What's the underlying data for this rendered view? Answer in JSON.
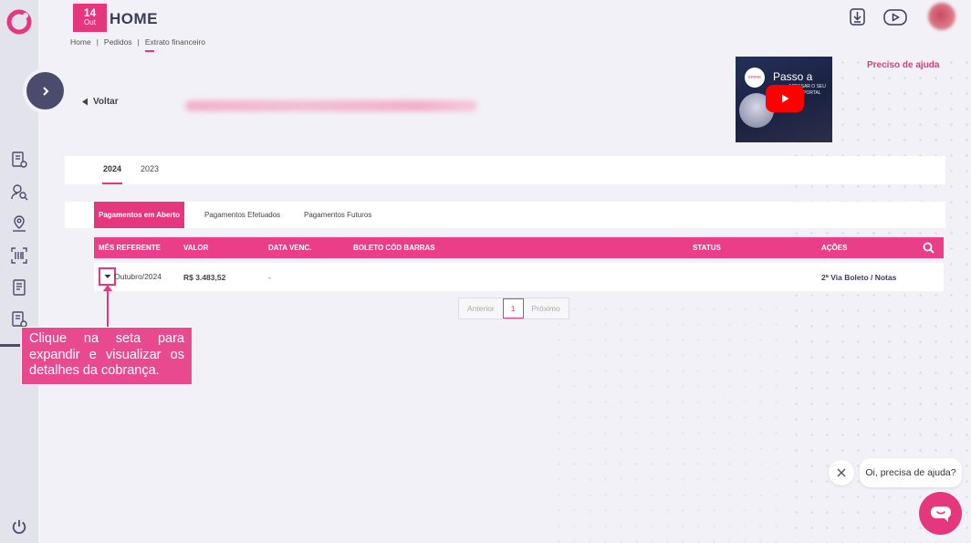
{
  "header": {
    "date_day": "14",
    "date_month": "Out",
    "title": "HOME",
    "breadcrumb": [
      "Home",
      "Pedidos",
      "Extrato financeiro"
    ],
    "breadcrumb_sep": "|"
  },
  "back_label": "Voltar",
  "help": {
    "title": "Preciso de ajuda",
    "video_title": "Passo a",
    "video_logo": "emme",
    "video_sub": "ACESSAR O SEU NOVO PORTAL"
  },
  "year_tabs": [
    "2024",
    "2023"
  ],
  "status_tabs": [
    "Pagamentos em Aberto",
    "Pagamentos Efetuados",
    "Pagamentos Futuros"
  ],
  "table": {
    "columns": [
      "MÊS REFERENTE",
      "VALOR",
      "DATA VENC.",
      "BOLETO CÓD BARRAS",
      "STATUS",
      "AÇÕES"
    ],
    "rows": [
      {
        "month": "Outubro/2024",
        "value": "R$ 3.483,52",
        "due": "-",
        "barcode": "",
        "status": "",
        "action": "2ª Via Boleto / Notas"
      }
    ]
  },
  "pager": {
    "prev": "Anterior",
    "page": "1",
    "next": "Próximo"
  },
  "tooltip": "Clique na seta para expandir e visualizar os detalhes da cobrança.",
  "chat": {
    "message": "Oi, precisa de ajuda?"
  },
  "colors": {
    "accent": "#e5367e",
    "sidebar": "#e3e3ec",
    "dark": "#4b4b6d"
  }
}
